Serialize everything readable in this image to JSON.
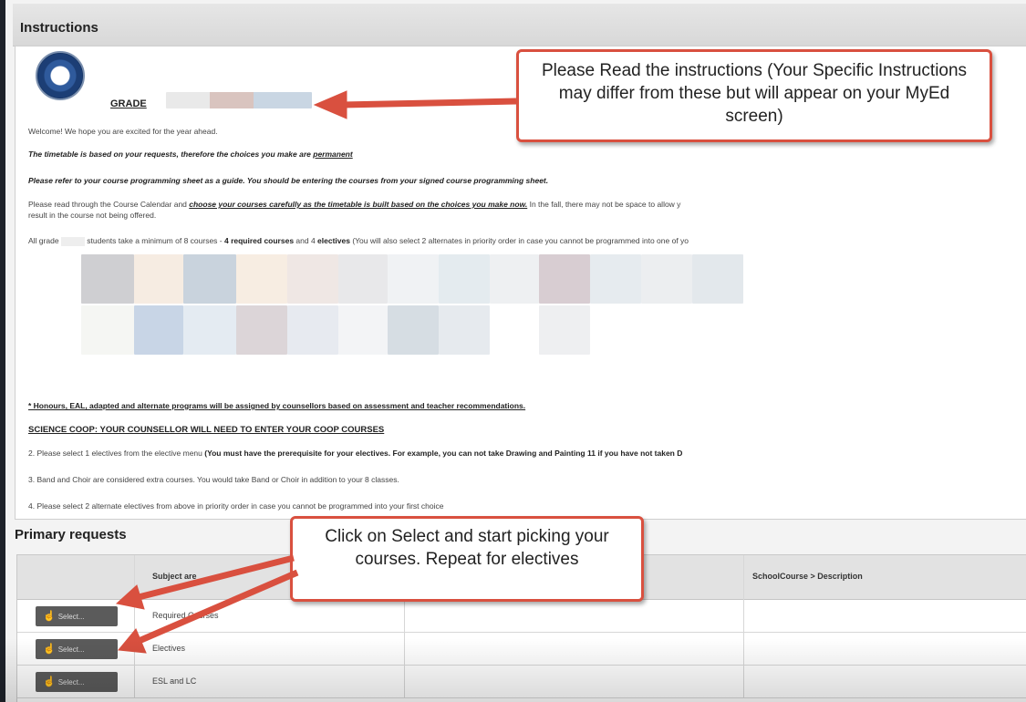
{
  "instructions_header": {
    "title": "Instructions"
  },
  "content": {
    "grade_label": "GRADE",
    "welcome": "Welcome! We hope you are excited for the year ahead.",
    "timetable_note_prefix": "The timetable is based on your requests, therefore the choices you make are ",
    "timetable_note_emphasis": "permanent",
    "refer_note": "Please refer to your course programming sheet as a guide. You should be entering the courses from your signed course programming sheet.",
    "calendar_prefix": "Please read through the Course Calendar and ",
    "calendar_emphasis": "choose your courses carefully as the timetable is built based on the choices you make now.",
    "calendar_suffix": " In the fall, there may not be space to allow y",
    "calendar_line2": "result in the course not being offered.",
    "all_grade_prefix": "All grade ",
    "all_grade_mid": " students take a minimum of 8 courses - ",
    "all_grade_required": "4 required courses",
    "all_grade_and": " and 4 ",
    "all_grade_electives": "electives",
    "all_grade_suffix": "  (You will also select 2 alternates in priority order in case you cannot be programmed into one of yo",
    "honours_note": "* Honours, EAL, adapted and alternate programs will be assigned by counsellors based on assessment and teacher recommendations.",
    "science_coop": "SCIENCE COOP: YOUR COUNSELLOR WILL NEED TO ENTER YOUR COOP COURSES",
    "item2_prefix": "2.  Please select 1 electives from the elective menu ",
    "item2_bold": "(You must have the prerequisite for your electives. For example, you can not take Drawing and Painting 11 if you have not taken D",
    "item3": "3. Band and Choir are considered extra courses. You would take Band or Choir in addition to your 8 classes.",
    "item4": "4.  Please select 2 alternate electives from above in priority order in case you cannot be programmed into your first choice"
  },
  "callouts": {
    "read_instructions": "Please Read the instructions (Your Specific Instructions may differ from these but will appear on your MyEd screen)",
    "click_select": "Click on Select and start picking your courses. Repeat for electives"
  },
  "primary_requests": {
    "title": "Primary requests",
    "columns": [
      "Subject are",
      "SchoolCourse > Description"
    ],
    "rows": [
      {
        "button": "Select...",
        "label": "Required Courses"
      },
      {
        "button": "Select...",
        "label": "Electives"
      },
      {
        "button": "Select...",
        "label": "ESL and LC"
      }
    ]
  },
  "colors": {
    "accent_red": "#d9503f",
    "button_gray": "#5b5b5b"
  }
}
